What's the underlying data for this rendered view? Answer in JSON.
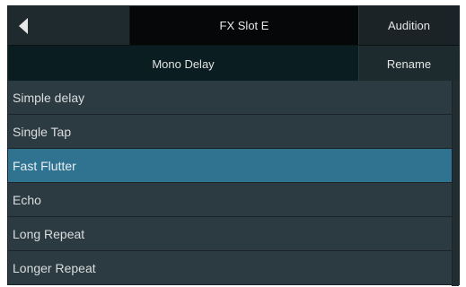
{
  "header": {
    "back_icon": "back-arrow-icon",
    "title": "FX Slot E",
    "audition_label": "Audition"
  },
  "effect": {
    "name": "Mono Delay",
    "rename_label": "Rename"
  },
  "presets": {
    "items": [
      {
        "label": "Simple delay",
        "selected": false
      },
      {
        "label": "Single Tap",
        "selected": false
      },
      {
        "label": "Fast Flutter",
        "selected": true
      },
      {
        "label": "Echo",
        "selected": false
      },
      {
        "label": "Long Repeat",
        "selected": false
      },
      {
        "label": "Longer Repeat",
        "selected": false
      }
    ]
  },
  "colors": {
    "panel": "#2b3a40",
    "selected": "#2f7391",
    "title_bg": "#050708"
  }
}
